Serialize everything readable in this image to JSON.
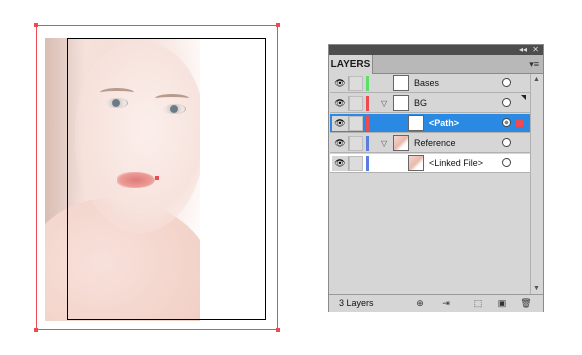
{
  "panel": {
    "tab_label": "LAYERS",
    "collapse_glyph": "◂◂",
    "close_glyph": "✕",
    "menu_glyph": "▾≡",
    "layer_count": "3 Layers",
    "layers": [
      {
        "label": "Bases",
        "color": "#59e06a",
        "expanded": null,
        "selected": false
      },
      {
        "label": "BG",
        "color": "#ef4a52",
        "expanded": true,
        "selected": false
      },
      {
        "label": "<Path>",
        "color": "#ef4a52",
        "expanded": null,
        "selected": true
      },
      {
        "label": "Reference",
        "color": "#5a7be0",
        "expanded": true,
        "selected": false
      },
      {
        "label": "<Linked File>",
        "color": "#5a7be0",
        "expanded": null,
        "selected": false
      }
    ],
    "bottom_icons": [
      "locate-object-icon",
      "make-clipping-mask-icon",
      "create-sublayer-icon",
      "new-layer-icon",
      "delete-icon"
    ]
  },
  "colors": {
    "selection_red": "#ef4a52",
    "selected_row_blue": "#2a8ae3",
    "panel_grey": "#d6d6d6"
  }
}
